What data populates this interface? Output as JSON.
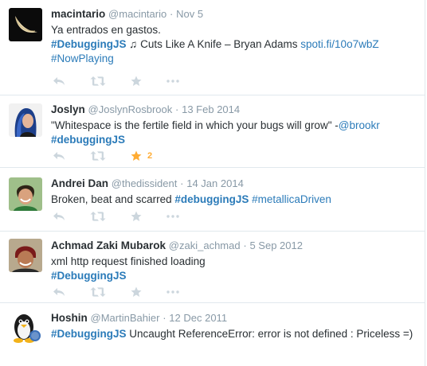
{
  "tweets": [
    {
      "name": "macintario",
      "handle": "@macintario",
      "date": "Nov 5",
      "line1": "Ya entrados en gastos.",
      "line2_tag": "#DebuggingJS",
      "line2_note": "♫",
      "line2_text": " Cuts Like A Knife – Bryan Adams ",
      "line2_link": "spoti.fi/10o7wbZ",
      "line3_tag": "#NowPlaying"
    },
    {
      "name": "Joslyn",
      "handle": "@JoslynRosbrook",
      "date": "13 Feb 2014",
      "line1_text": "\"Whitespace is the fertile field in which your bugs will grow\" -",
      "line1_mention": "@brookr",
      "line2_tag": "#debuggingJS",
      "favorite_count": "2"
    },
    {
      "name": "Andrei Dan",
      "handle": "@thedissident",
      "date": "14 Jan 2014",
      "line1_text": "Broken, beat and scarred ",
      "line1_tag": "#debuggingJS",
      "line1_tag2": "#metallicaDriven"
    },
    {
      "name": "Achmad Zaki Mubarok",
      "handle": "@zaki_achmad",
      "date": "5 Sep 2012",
      "line1": "xml http request finished loading",
      "line2_tag": "#DebuggingJS"
    },
    {
      "name": "Hoshin",
      "handle": "@MartinBahier",
      "date": "12 Dec 2011",
      "line1_tag": "#DebuggingJS",
      "line1_text": " Uncaught ReferenceError: error is not defined : Priceless =)"
    }
  ],
  "separator": "·",
  "icons": {
    "reply": "reply-icon",
    "retweet": "retweet-icon",
    "favorite": "star-icon",
    "more": "more-dots-icon"
  },
  "colors": {
    "link": "#2b7bb9",
    "muted": "#8899a6",
    "icon": "#ccd6dd",
    "favorited": "#ffac33"
  }
}
